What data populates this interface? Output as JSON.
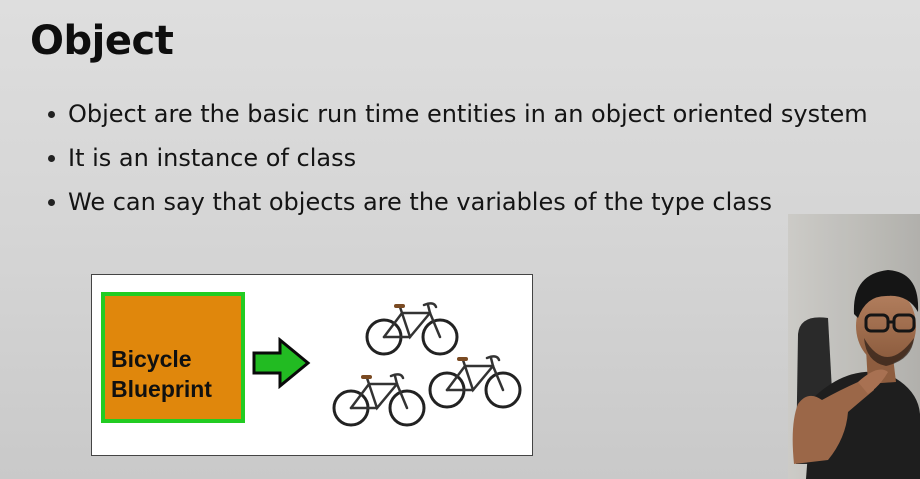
{
  "slide": {
    "title": "Object",
    "bullets": [
      "Object are the basic run time entities in an object oriented system",
      "It is an instance of class",
      "We can say that objects are the variables of the type class"
    ]
  },
  "figure": {
    "blueprint_line1": "Bicycle",
    "blueprint_line2": "Blueprint",
    "blueprint_color": "#e0870c",
    "blueprint_border_color": "#22cc22",
    "arrow_color": "#22bb22",
    "bike_icon": "bicycle-icon"
  },
  "webcam": {
    "icon": "presenter-video"
  }
}
